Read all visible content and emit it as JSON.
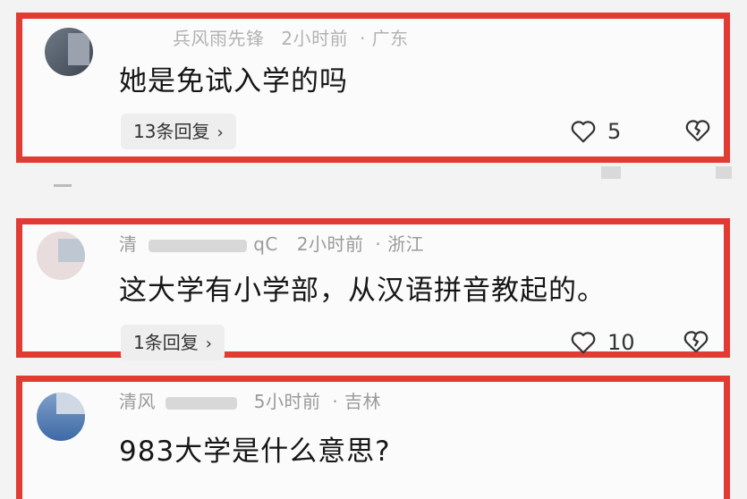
{
  "comments": [
    {
      "user": "兵风雨先锋",
      "time": "2小时前",
      "location": "广东",
      "text": "她是免试入学的吗",
      "replies_label": "13条回复",
      "likes": "5"
    },
    {
      "user_prefix": "清",
      "user_suffix": "qC",
      "time": "2小时前",
      "location": "浙江",
      "text": "这大学有小学部，从汉语拼音教起的。",
      "replies_label": "1条回复",
      "likes": "10"
    },
    {
      "user_prefix": "清风",
      "time": "5小时前",
      "location": "吉林",
      "text": "983大学是什么意思?"
    }
  ],
  "separator_dot": "·",
  "chevron": "›",
  "colors": {
    "highlight_border": "#e23b33",
    "meta_text": "#9a9a9a",
    "body_text": "#161616"
  }
}
